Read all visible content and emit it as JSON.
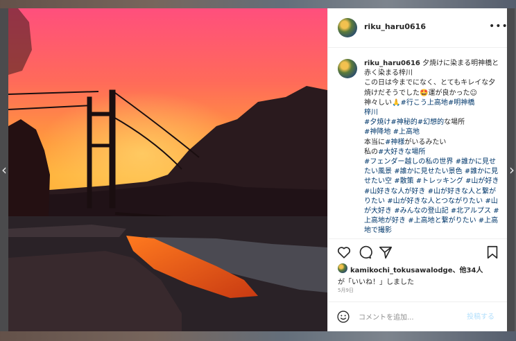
{
  "post": {
    "username": "riku_haru0616",
    "caption_user": "riku_haru0616",
    "caption_lines": [
      {
        "text": " 夕焼けに染まる明神橋と赤く染まる梓川",
        "tag": false
      },
      {
        "text": "\nこの日は今までになく、とてもキレイな夕焼けだそうでした🤩運が良かった☺",
        "tag": false
      },
      {
        "text": "\n神々しい🙏",
        "tag": false
      },
      {
        "text": "#行こう上高地",
        "tag": true
      },
      {
        "text": "#明神橋",
        "tag": true
      },
      {
        "text": "\n",
        "tag": false
      },
      {
        "text": "梓川",
        "tag": true
      },
      {
        "text": "\n",
        "tag": false
      },
      {
        "text": "#夕焼け",
        "tag": true
      },
      {
        "text": "#神秘的",
        "tag": true
      },
      {
        "text": "#幻想的",
        "tag": true
      },
      {
        "text": "な場所",
        "tag": false
      },
      {
        "text": "\n",
        "tag": false
      },
      {
        "text": "#神降地",
        "tag": true
      },
      {
        "text": " ",
        "tag": false
      },
      {
        "text": "#上高地",
        "tag": true
      },
      {
        "text": "\n本当に",
        "tag": false
      },
      {
        "text": "#神様",
        "tag": true
      },
      {
        "text": "がいるみたい\n私の",
        "tag": false
      },
      {
        "text": "#大好きな場所",
        "tag": true
      },
      {
        "text": "\n",
        "tag": false
      },
      {
        "text": "#フェンダー越しの私の世界",
        "tag": true
      },
      {
        "text": " ",
        "tag": false
      },
      {
        "text": "#誰かに見せたい風景",
        "tag": true
      },
      {
        "text": " ",
        "tag": false
      },
      {
        "text": "#誰かに見せたい景色",
        "tag": true
      },
      {
        "text": " ",
        "tag": false
      },
      {
        "text": "#誰かに見せたい空",
        "tag": true
      },
      {
        "text": " ",
        "tag": false
      },
      {
        "text": "#散策",
        "tag": true
      },
      {
        "text": " ",
        "tag": false
      },
      {
        "text": "#トレッキング",
        "tag": true
      },
      {
        "text": " ",
        "tag": false
      },
      {
        "text": "#山が好き",
        "tag": true
      },
      {
        "text": " ",
        "tag": false
      },
      {
        "text": "#山好きな人が好き",
        "tag": true
      },
      {
        "text": " ",
        "tag": false
      },
      {
        "text": "#山が好きな人と繋がりたい",
        "tag": true
      },
      {
        "text": " ",
        "tag": false
      },
      {
        "text": "#山が好きな人とつながりたい",
        "tag": true
      },
      {
        "text": " ",
        "tag": false
      },
      {
        "text": "#山が大好き",
        "tag": true
      },
      {
        "text": " ",
        "tag": false
      },
      {
        "text": "#みんなの登山記",
        "tag": true
      },
      {
        "text": " ",
        "tag": false
      },
      {
        "text": "#北アルプス",
        "tag": true
      },
      {
        "text": " ",
        "tag": false
      },
      {
        "text": "#上高地が好き",
        "tag": true
      },
      {
        "text": " ",
        "tag": false
      },
      {
        "text": "#上高地と繋がりたい",
        "tag": true
      },
      {
        "text": " ",
        "tag": false
      },
      {
        "text": "#上高地で撮影",
        "tag": true
      }
    ],
    "likes_user": "kamikochi_tokusawalodge、他34人",
    "likes_suffix": "が「いいね！」しました",
    "date": "5月9日",
    "comment_placeholder": "コメントを追加...",
    "post_button_label": "投稿する"
  },
  "icons": {
    "more": "more-horizontal-icon",
    "like": "heart-icon",
    "comment": "comment-icon",
    "share": "share-icon",
    "save": "bookmark-icon",
    "emoji": "emoji-icon",
    "prev": "chevron-left-icon",
    "next": "chevron-right-icon"
  },
  "colors": {
    "tag": "#00376b",
    "text": "#262626",
    "muted": "#8e8e8e",
    "post_button": "#b2dffc",
    "sunset_top": "#ff5f7a",
    "sunset_bottom": "#ffb13a"
  }
}
